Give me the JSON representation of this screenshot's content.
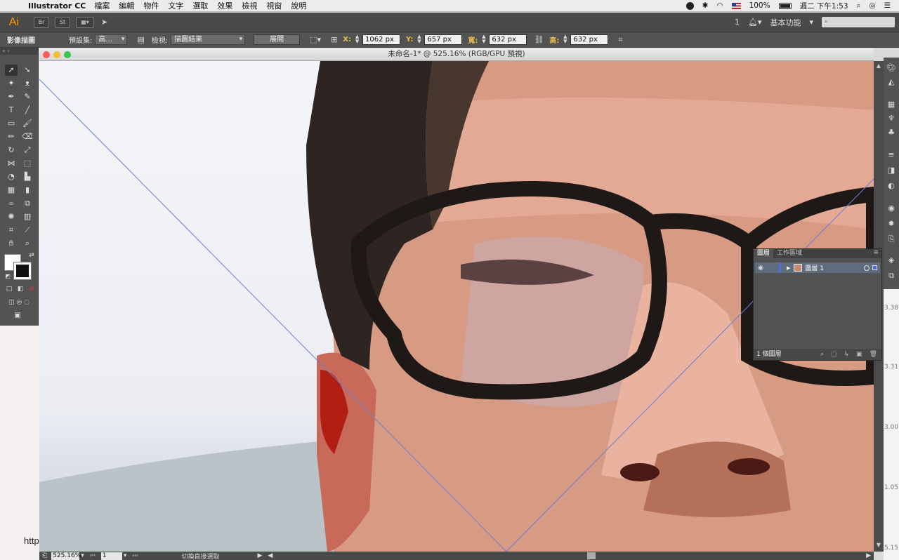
{
  "menubar": {
    "apple": "",
    "app": "Illustrator CC",
    "menus": [
      "檔案",
      "編輯",
      "物件",
      "文字",
      "選取",
      "效果",
      "檢視",
      "視窗",
      "說明"
    ],
    "battery": "100%",
    "clock": "週二 下午1:53"
  },
  "appbar": {
    "logo": "Ai",
    "bridge_label": "Br",
    "stock_label": "St",
    "notifications": "1",
    "workspace": "基本功能",
    "search_placeholder": ""
  },
  "control": {
    "panel_name": "影像描圖",
    "preset_label": "預設集:",
    "preset_value": "高...",
    "view_label": "檢視:",
    "view_value": "描圖結果",
    "expand_button": "展開",
    "x_label": "X:",
    "x_value": "1062 px",
    "y_label": "Y:",
    "y_value": "657 px",
    "w_label": "寬:",
    "w_value": "632 px",
    "h_label": "高:",
    "h_value": "632 px"
  },
  "document": {
    "title": "未命名-1* @ 525.16% (RGB/GPU 預視)"
  },
  "desktop": {
    "url_fragment": "http"
  },
  "layers_panel": {
    "tabs": [
      "圖層",
      "工作區域"
    ],
    "active_tab": "圖層",
    "layer_name": "圖層 1",
    "count_text": "1 個圖層"
  },
  "statusbar": {
    "zoom": "525.16%",
    "page": "1",
    "status_text": "切換直接選取"
  },
  "side_ruler_labels": [
    "3.38",
    "3.31",
    "3.00",
    "1.05",
    "5.15"
  ]
}
